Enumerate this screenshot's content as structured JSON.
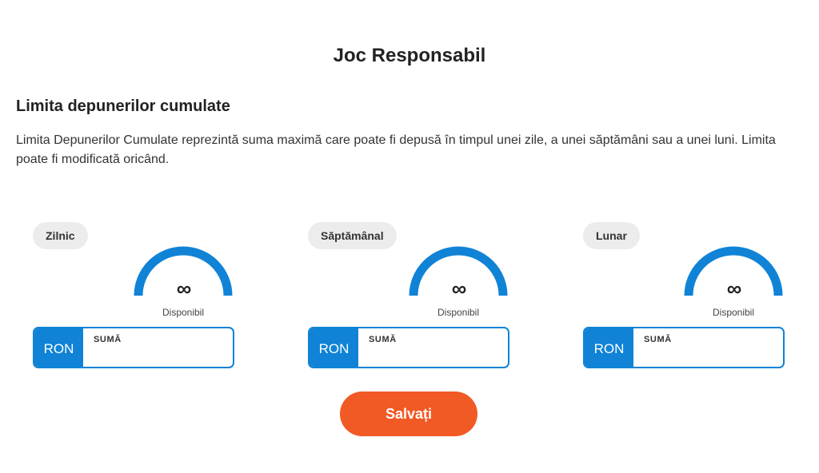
{
  "page": {
    "title": "Joc Responsabil",
    "section_title": "Limita depunerilor cumulate",
    "description": "Limita Depunerilor Cumulate reprezintă suma maximă care poate fi depusă în timpul unei zile, a unei săptămâni sau a unei luni. Limita poate fi modificată oricând."
  },
  "limits": [
    {
      "period": "Zilnic",
      "value": "∞",
      "status": "Disponibil",
      "currency": "RON",
      "amount_label": "SUMĂ",
      "amount_value": ""
    },
    {
      "period": "Săptămânal",
      "value": "∞",
      "status": "Disponibil",
      "currency": "RON",
      "amount_label": "SUMĂ",
      "amount_value": ""
    },
    {
      "period": "Lunar",
      "value": "∞",
      "status": "Disponibil",
      "currency": "RON",
      "amount_label": "SUMĂ",
      "amount_value": ""
    }
  ],
  "actions": {
    "save_label": "Salvați"
  },
  "colors": {
    "accent": "#1083d6",
    "primary_button": "#f15a24",
    "badge_bg": "#ececec"
  },
  "icons": {
    "gauge": "gauge-arc-icon",
    "infinity": "infinity-icon"
  }
}
